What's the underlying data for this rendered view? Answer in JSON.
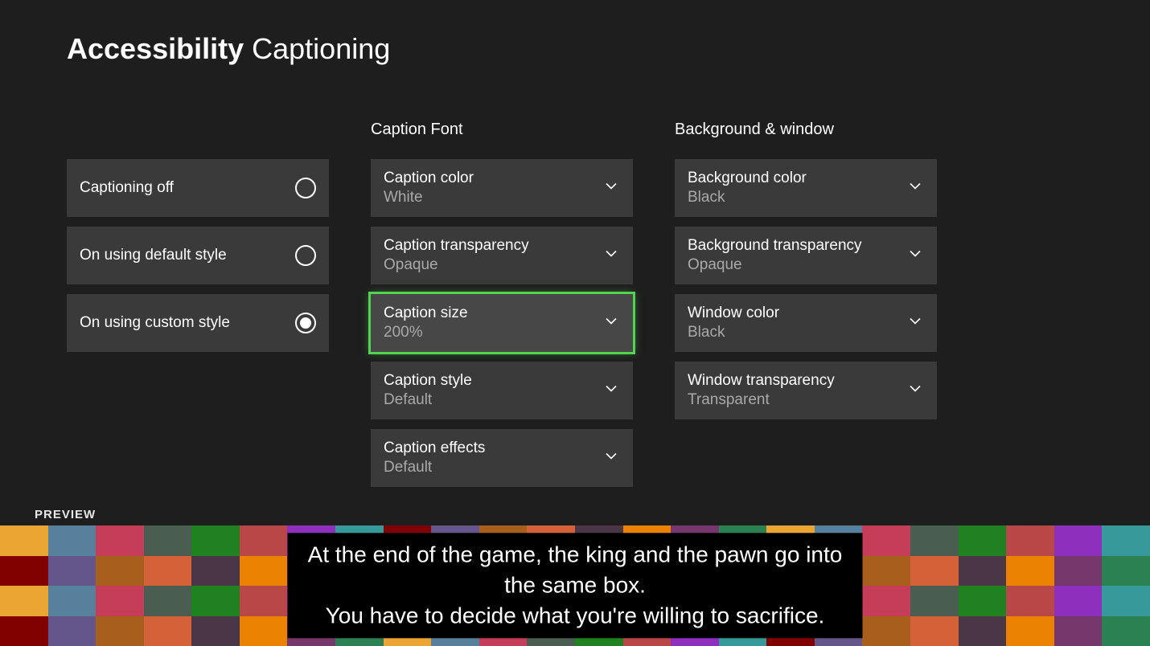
{
  "colors": {
    "background": "#1e1e1e",
    "tile": "#3a3a3a",
    "tile_focused": "#474747",
    "text_primary": "#ffffff",
    "text_secondary": "#a9a9a9",
    "focus_ring": "#52d352"
  },
  "header": {
    "title_bold": "Accessibility",
    "title_rest": "Captioning"
  },
  "left": {
    "options": [
      {
        "label": "Captioning off",
        "checked": false
      },
      {
        "label": "On using default style",
        "checked": false
      },
      {
        "label": "On using custom style",
        "checked": true
      }
    ]
  },
  "font_section": {
    "title": "Caption Font",
    "items": [
      {
        "label": "Caption color",
        "value": "White",
        "focused": false
      },
      {
        "label": "Caption transparency",
        "value": "Opaque",
        "focused": false
      },
      {
        "label": "Caption size",
        "value": "200%",
        "focused": true
      },
      {
        "label": "Caption style",
        "value": "Default",
        "focused": false
      },
      {
        "label": "Caption effects",
        "value": "Default",
        "focused": false
      }
    ]
  },
  "bg_section": {
    "title": "Background & window",
    "items": [
      {
        "label": "Background color",
        "value": "Black",
        "focused": false
      },
      {
        "label": "Background transparency",
        "value": "Opaque",
        "focused": false
      },
      {
        "label": "Window color",
        "value": "Black",
        "focused": false
      },
      {
        "label": "Window transparency",
        "value": "Transparent",
        "focused": false
      }
    ]
  },
  "preview": {
    "label": "PREVIEW",
    "caption_line1": "At the end of the game, the king and the pawn go into the same box.",
    "caption_line2": "You have to decide what you're willing to sacrifice."
  }
}
